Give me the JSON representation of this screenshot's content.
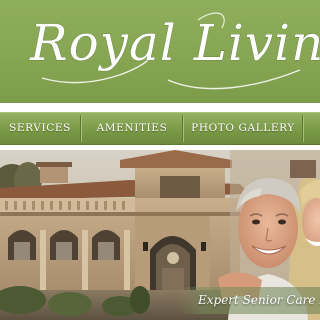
{
  "brand": {
    "name": "Royal Living",
    "colors": {
      "header_green": "#86a653",
      "nav_green": "#7b9a47",
      "text": "#ffffff"
    }
  },
  "nav": {
    "items": [
      {
        "label": "SERVICES"
      },
      {
        "label": "AMENITIES"
      },
      {
        "label": "PHOTO GALLERY"
      }
    ]
  },
  "hero": {
    "tagline": "Expert Senior Care I",
    "image": "villa-building-with-smiling-senior-couple"
  }
}
